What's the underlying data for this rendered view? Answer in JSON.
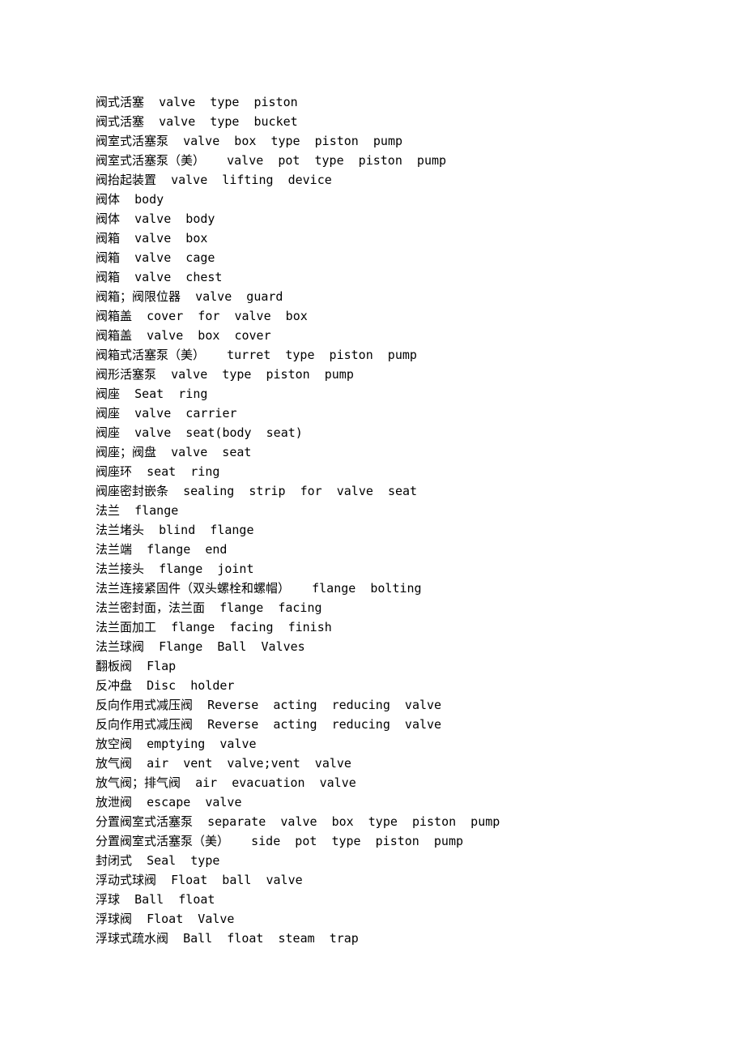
{
  "entries": [
    {
      "cn": "阀式活塞",
      "en": "valve  type  piston"
    },
    {
      "cn": "阀式活塞",
      "en": "valve  type  bucket"
    },
    {
      "cn": "阀室式活塞泵",
      "en": "valve  box  type  piston  pump"
    },
    {
      "cn": "阀室式活塞泵（美）",
      "en": " valve  pot  type  piston  pump"
    },
    {
      "cn": "阀抬起装置",
      "en": "valve  lifting  device"
    },
    {
      "cn": "阀体",
      "en": "body"
    },
    {
      "cn": "阀体",
      "en": "valve  body"
    },
    {
      "cn": "阀箱",
      "en": "valve  box"
    },
    {
      "cn": "阀箱",
      "en": "valve  cage"
    },
    {
      "cn": "阀箱",
      "en": "valve  chest"
    },
    {
      "cn": "阀箱；阀限位器",
      "en": "valve  guard"
    },
    {
      "cn": "阀箱盖",
      "en": "cover  for  valve  box"
    },
    {
      "cn": "阀箱盖",
      "en": "valve  box  cover"
    },
    {
      "cn": "阀箱式活塞泵（美）",
      "en": " turret  type  piston  pump"
    },
    {
      "cn": "阀形活塞泵",
      "en": "valve  type  piston  pump"
    },
    {
      "cn": "阀座",
      "en": "Seat  ring"
    },
    {
      "cn": "阀座",
      "en": "valve  carrier"
    },
    {
      "cn": "阀座",
      "en": "valve  seat(body  seat)"
    },
    {
      "cn": "阀座；阀盘",
      "en": "valve  seat"
    },
    {
      "cn": "阀座环",
      "en": "seat  ring"
    },
    {
      "cn": "阀座密封嵌条",
      "en": "sealing  strip  for  valve  seat"
    },
    {
      "cn": "法兰",
      "en": "flange"
    },
    {
      "cn": "法兰堵头",
      "en": "blind  flange"
    },
    {
      "cn": "法兰端",
      "en": "flange  end"
    },
    {
      "cn": "法兰接头",
      "en": "flange  joint"
    },
    {
      "cn": "法兰连接紧固件（双头螺栓和螺帽）",
      "en": " flange  bolting"
    },
    {
      "cn": "法兰密封面，法兰面",
      "en": "flange  facing"
    },
    {
      "cn": "法兰面加工",
      "en": "flange  facing  finish"
    },
    {
      "cn": "法兰球阀",
      "en": "Flange  Ball  Valves"
    },
    {
      "cn": "翻板阀",
      "en": "Flap"
    },
    {
      "cn": "反冲盘",
      "en": "Disc  holder"
    },
    {
      "cn": "反向作用式减压阀",
      "en": "Reverse  acting  reducing  valve"
    },
    {
      "cn": "反向作用式减压阀",
      "en": "Reverse  acting  reducing  valve"
    },
    {
      "cn": "放空阀",
      "en": "emptying  valve"
    },
    {
      "cn": "放气阀",
      "en": "air  vent  valve;vent  valve"
    },
    {
      "cn": "放气阀；排气阀",
      "en": "air  evacuation  valve"
    },
    {
      "cn": "放泄阀",
      "en": "escape  valve"
    },
    {
      "cn": "分置阀室式活塞泵",
      "en": "separate  valve  box  type  piston  pump"
    },
    {
      "cn": "分置阀室式活塞泵（美）",
      "en": " side  pot  type  piston  pump"
    },
    {
      "cn": "封闭式",
      "en": "Seal  type"
    },
    {
      "cn": "浮动式球阀",
      "en": "Float  ball  valve"
    },
    {
      "cn": "浮球",
      "en": "Ball  float"
    },
    {
      "cn": "浮球阀",
      "en": "Float  Valve"
    },
    {
      "cn": "浮球式疏水阀",
      "en": "Ball  float  steam  trap"
    }
  ]
}
